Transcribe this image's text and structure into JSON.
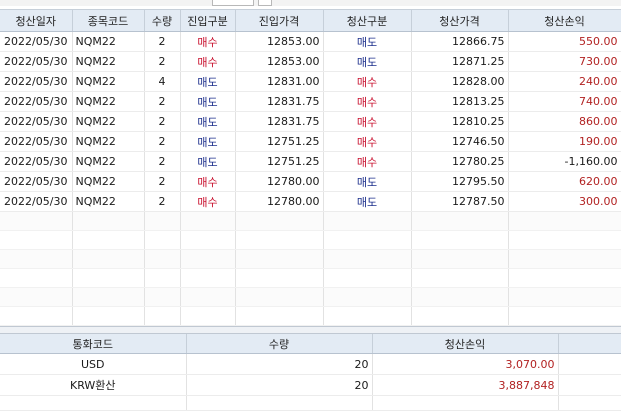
{
  "trades": {
    "columns": [
      "청산일자",
      "종목코드",
      "수량",
      "진입구분",
      "진입가격",
      "청산구분",
      "청산가격",
      "청산손익"
    ],
    "rows": [
      {
        "date": "2022/05/30",
        "code": "NQM22",
        "qty": "2",
        "entry_side": "매수",
        "entry_price": "12853.00",
        "exit_side": "매도",
        "exit_price": "12866.75",
        "pnl": "550.00"
      },
      {
        "date": "2022/05/30",
        "code": "NQM22",
        "qty": "2",
        "entry_side": "매수",
        "entry_price": "12853.00",
        "exit_side": "매도",
        "exit_price": "12871.25",
        "pnl": "730.00"
      },
      {
        "date": "2022/05/30",
        "code": "NQM22",
        "qty": "4",
        "entry_side": "매도",
        "entry_price": "12831.00",
        "exit_side": "매수",
        "exit_price": "12828.00",
        "pnl": "240.00"
      },
      {
        "date": "2022/05/30",
        "code": "NQM22",
        "qty": "2",
        "entry_side": "매도",
        "entry_price": "12831.75",
        "exit_side": "매수",
        "exit_price": "12813.25",
        "pnl": "740.00"
      },
      {
        "date": "2022/05/30",
        "code": "NQM22",
        "qty": "2",
        "entry_side": "매도",
        "entry_price": "12831.75",
        "exit_side": "매수",
        "exit_price": "12810.25",
        "pnl": "860.00"
      },
      {
        "date": "2022/05/30",
        "code": "NQM22",
        "qty": "2",
        "entry_side": "매도",
        "entry_price": "12751.25",
        "exit_side": "매수",
        "exit_price": "12746.50",
        "pnl": "190.00"
      },
      {
        "date": "2022/05/30",
        "code": "NQM22",
        "qty": "2",
        "entry_side": "매도",
        "entry_price": "12751.25",
        "exit_side": "매수",
        "exit_price": "12780.25",
        "pnl": "-1,160.00"
      },
      {
        "date": "2022/05/30",
        "code": "NQM22",
        "qty": "2",
        "entry_side": "매수",
        "entry_price": "12780.00",
        "exit_side": "매도",
        "exit_price": "12795.50",
        "pnl": "620.00"
      },
      {
        "date": "2022/05/30",
        "code": "NQM22",
        "qty": "2",
        "entry_side": "매수",
        "entry_price": "12780.00",
        "exit_side": "매도",
        "exit_price": "12787.50",
        "pnl": "300.00"
      }
    ]
  },
  "summary": {
    "columns": [
      "통화코드",
      "수량",
      "청산손익"
    ],
    "rows": [
      {
        "currency": "USD",
        "qty": "20",
        "pnl": "3,070.00"
      },
      {
        "currency": "KRW환산",
        "qty": "20",
        "pnl": "3,887,848"
      }
    ]
  },
  "colors": {
    "buy": "#c8102e",
    "sell": "#1c2f8c",
    "profit": "#b22222",
    "header_bg": "#e3ebf4"
  }
}
